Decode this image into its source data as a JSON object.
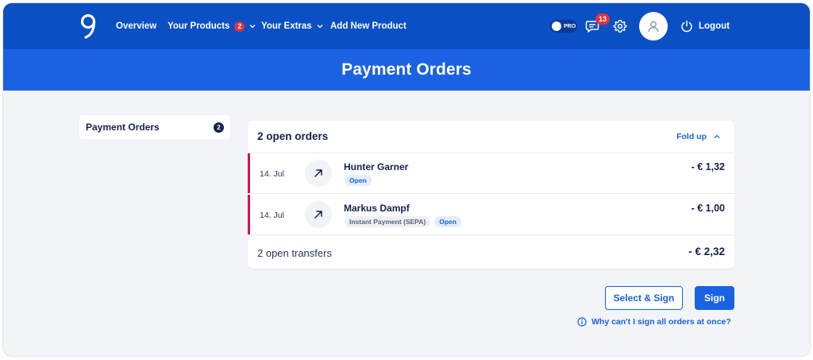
{
  "header": {
    "nav": [
      {
        "label": "Overview"
      },
      {
        "label": "Your Products",
        "badge": "2",
        "has_dropdown": true
      },
      {
        "label": "Your Extras",
        "has_dropdown": true
      },
      {
        "label": "Add New Product"
      }
    ],
    "pro_toggle_label": "PRO",
    "messages_badge": "13",
    "logout_label": "Logout"
  },
  "page_title": "Payment Orders",
  "sidebar": {
    "label": "Payment Orders",
    "count": "2"
  },
  "orders_card": {
    "title": "2 open orders",
    "fold_label": "Fold up",
    "rows": [
      {
        "date": "14. Jul",
        "name": "Hunter Garner",
        "tags": [
          {
            "label": "Open",
            "kind": "open"
          }
        ],
        "amount": "- € 1,32"
      },
      {
        "date": "14. Jul",
        "name": "Markus Dampf",
        "tags": [
          {
            "label": "Instant Payment (SEPA)",
            "kind": "sepa"
          },
          {
            "label": "Open",
            "kind": "open"
          }
        ],
        "amount": "- € 1,00"
      }
    ],
    "total_label": "2 open transfers",
    "total_amount": "- € 2,32"
  },
  "actions": {
    "select_sign_label": "Select & Sign",
    "sign_label": "Sign",
    "help_label": "Why can't I sign all orders at once?"
  },
  "colors": {
    "header_bg": "#0b4fc4",
    "hero_bg": "#1a62e2",
    "accent": "#1a62e2",
    "open_indicator": "#d3164e",
    "badge": "#e5303c"
  }
}
